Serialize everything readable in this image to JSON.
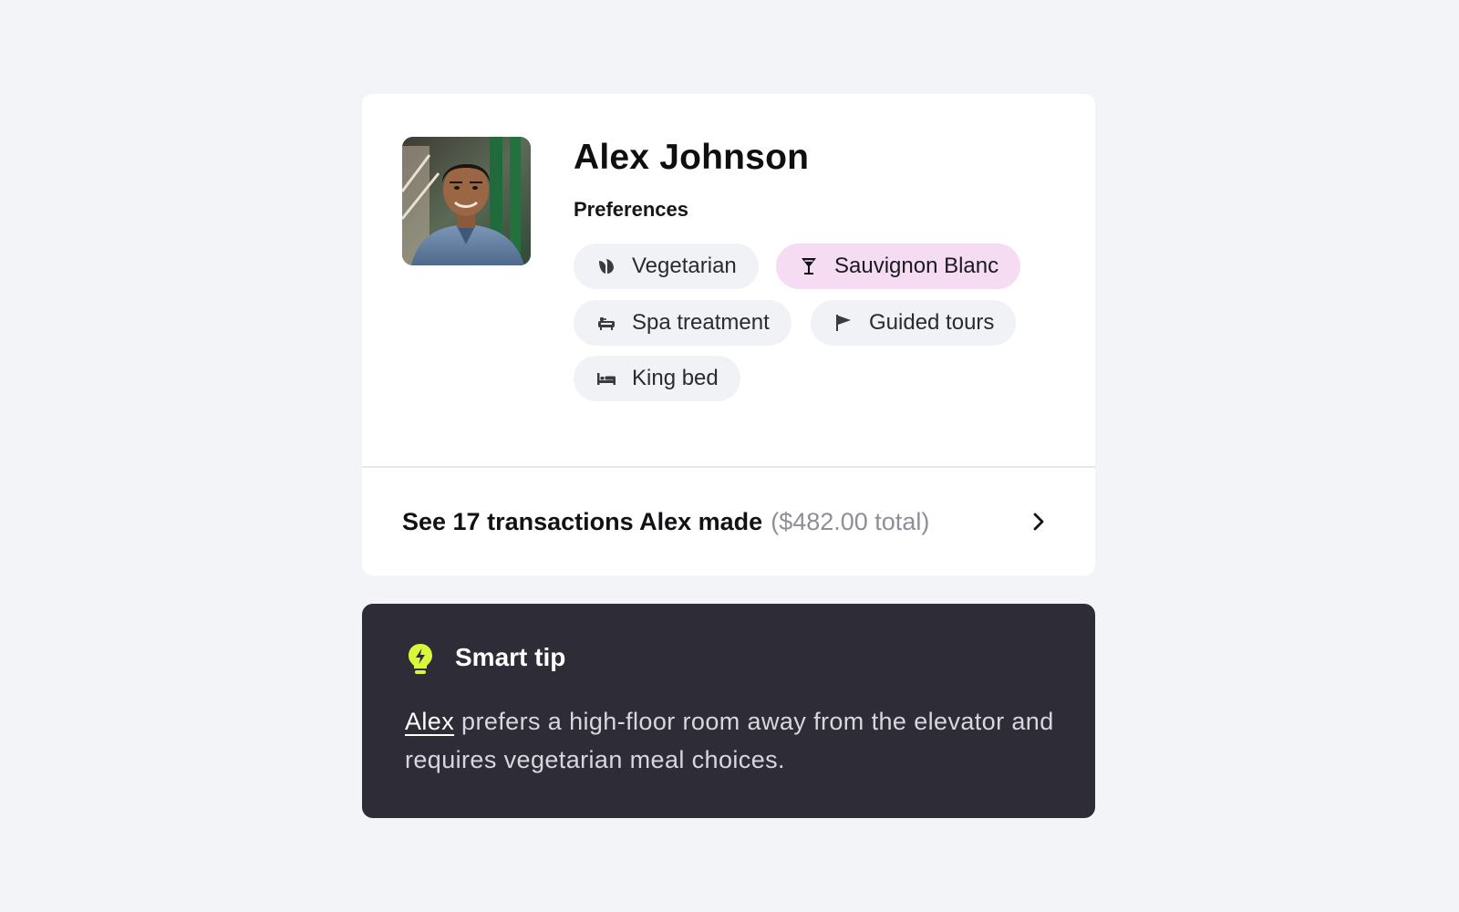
{
  "guest": {
    "name": "Alex Johnson",
    "avatar_alt": "Alex Johnson"
  },
  "preferences": {
    "label": "Preferences",
    "items": [
      {
        "label": "Vegetarian",
        "icon": "leaf-icon"
      },
      {
        "label": "Sauvignon Blanc",
        "icon": "wine-glass-icon",
        "highlight_color": "#f6dcf3"
      },
      {
        "label": "Spa treatment",
        "icon": "bathtub-icon"
      },
      {
        "label": "Guided tours",
        "icon": "flag-icon"
      },
      {
        "label": "King bed",
        "icon": "bed-icon"
      }
    ]
  },
  "transactions": {
    "summary": "See 17 transactions Alex made",
    "total": "($482.00 total)"
  },
  "smart_tip": {
    "title": "Smart tip",
    "icon": "lightbulb-icon",
    "icon_color": "#d7f93a",
    "guest_link": "Alex",
    "message": " prefers a high-floor room away from the elevator and requires vegetarian meal choices."
  },
  "colors": {
    "background": "#f3f4f7",
    "card": "#ffffff",
    "tip_background": "#2d2c37",
    "chip": "#f1f2f5",
    "chip_highlight": "#f6dcf3",
    "muted_text": "#8e8f96"
  }
}
